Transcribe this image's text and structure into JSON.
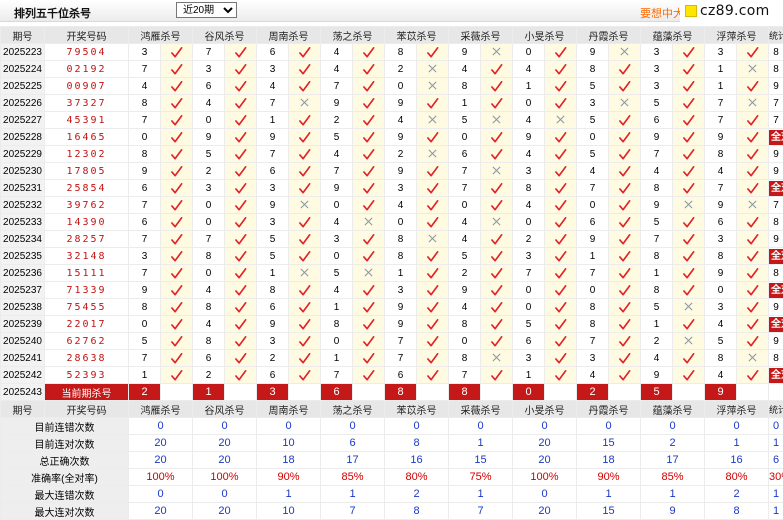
{
  "header": {
    "title": "排列五千位杀号",
    "select_value": "近20期",
    "promo": "要想中大"
  },
  "watermark": {
    "text": "cz89.com"
  },
  "columns": {
    "period": "期号",
    "draw": "开奖号码",
    "experts": [
      "鸿雁杀号",
      "谷风杀号",
      "周南杀号",
      "荡之杀号",
      "苯苡杀号",
      "采薇杀号",
      "小旻杀号",
      "丹霞杀号",
      "蕴藻杀号",
      "浮萍杀号"
    ],
    "stat": "统计"
  },
  "marks": {
    "hit": "✓",
    "miss": "✗",
    "all_correct": "全对"
  },
  "rows": [
    {
      "period": "2025223",
      "draw": "79504",
      "kills": [
        "3",
        "7",
        "6",
        "4",
        "8",
        "9",
        "0",
        "9",
        "3",
        "3"
      ],
      "hits": [
        1,
        1,
        1,
        1,
        1,
        0,
        1,
        0,
        1,
        1
      ],
      "stat": "8"
    },
    {
      "period": "2025224",
      "draw": "02192",
      "kills": [
        "7",
        "3",
        "3",
        "4",
        "2",
        "4",
        "4",
        "8",
        "3",
        "1"
      ],
      "hits": [
        1,
        1,
        1,
        1,
        0,
        1,
        1,
        1,
        1,
        0
      ],
      "stat": "8"
    },
    {
      "period": "2025225",
      "draw": "00907",
      "kills": [
        "4",
        "6",
        "4",
        "7",
        "0",
        "8",
        "1",
        "5",
        "3",
        "1"
      ],
      "hits": [
        1,
        1,
        1,
        1,
        0,
        1,
        1,
        1,
        1,
        1
      ],
      "stat": "9"
    },
    {
      "period": "2025226",
      "draw": "37327",
      "kills": [
        "8",
        "4",
        "7",
        "9",
        "9",
        "1",
        "0",
        "3",
        "5",
        "7"
      ],
      "hits": [
        1,
        1,
        0,
        1,
        1,
        1,
        1,
        0,
        1,
        0
      ],
      "stat": "7"
    },
    {
      "period": "2025227",
      "draw": "45391",
      "kills": [
        "7",
        "0",
        "1",
        "2",
        "4",
        "5",
        "4",
        "5",
        "6",
        "7"
      ],
      "hits": [
        1,
        1,
        1,
        1,
        0,
        0,
        0,
        1,
        1,
        1
      ],
      "stat": "7"
    },
    {
      "period": "2025228",
      "draw": "16465",
      "kills": [
        "0",
        "9",
        "9",
        "5",
        "9",
        "0",
        "9",
        "0",
        "9",
        "9"
      ],
      "hits": [
        1,
        1,
        1,
        1,
        1,
        1,
        1,
        1,
        1,
        1
      ],
      "stat": "全对"
    },
    {
      "period": "2025229",
      "draw": "12302",
      "kills": [
        "8",
        "5",
        "7",
        "4",
        "2",
        "6",
        "4",
        "5",
        "7",
        "8"
      ],
      "hits": [
        1,
        1,
        1,
        1,
        0,
        1,
        1,
        1,
        1,
        1
      ],
      "stat": "9"
    },
    {
      "period": "2025230",
      "draw": "17805",
      "kills": [
        "9",
        "2",
        "6",
        "7",
        "9",
        "7",
        "3",
        "4",
        "4",
        "4"
      ],
      "hits": [
        1,
        1,
        1,
        1,
        1,
        0,
        1,
        1,
        1,
        1
      ],
      "stat": "9"
    },
    {
      "period": "2025231",
      "draw": "25854",
      "kills": [
        "6",
        "3",
        "3",
        "9",
        "3",
        "7",
        "8",
        "7",
        "8",
        "7"
      ],
      "hits": [
        1,
        1,
        1,
        1,
        1,
        1,
        1,
        1,
        1,
        1
      ],
      "stat": "全对"
    },
    {
      "period": "2025232",
      "draw": "39762",
      "kills": [
        "7",
        "0",
        "9",
        "0",
        "4",
        "0",
        "4",
        "0",
        "9",
        "9"
      ],
      "hits": [
        1,
        1,
        0,
        1,
        1,
        1,
        1,
        1,
        0,
        0
      ],
      "stat": "7"
    },
    {
      "period": "2025233",
      "draw": "14390",
      "kills": [
        "6",
        "0",
        "3",
        "4",
        "0",
        "4",
        "0",
        "6",
        "5",
        "6"
      ],
      "hits": [
        1,
        1,
        1,
        0,
        1,
        0,
        1,
        1,
        1,
        1
      ],
      "stat": "8"
    },
    {
      "period": "2025234",
      "draw": "28257",
      "kills": [
        "7",
        "7",
        "5",
        "3",
        "8",
        "4",
        "2",
        "9",
        "7",
        "3"
      ],
      "hits": [
        1,
        1,
        1,
        1,
        0,
        1,
        1,
        1,
        1,
        1
      ],
      "stat": "9"
    },
    {
      "period": "2025235",
      "draw": "32148",
      "kills": [
        "3",
        "8",
        "5",
        "0",
        "8",
        "5",
        "3",
        "1",
        "8",
        "8"
      ],
      "hits": [
        1,
        1,
        1,
        1,
        1,
        1,
        1,
        1,
        1,
        1
      ],
      "stat": "全对"
    },
    {
      "period": "2025236",
      "draw": "15111",
      "kills": [
        "7",
        "0",
        "1",
        "5",
        "1",
        "2",
        "7",
        "7",
        "1",
        "9"
      ],
      "hits": [
        1,
        1,
        0,
        0,
        1,
        1,
        1,
        1,
        1,
        1
      ],
      "stat": "8"
    },
    {
      "period": "2025237",
      "draw": "71339",
      "kills": [
        "9",
        "4",
        "8",
        "4",
        "3",
        "9",
        "0",
        "0",
        "8",
        "0"
      ],
      "hits": [
        1,
        1,
        1,
        1,
        1,
        1,
        1,
        1,
        1,
        1
      ],
      "stat": "全对"
    },
    {
      "period": "2025238",
      "draw": "75455",
      "kills": [
        "8",
        "8",
        "6",
        "1",
        "9",
        "4",
        "0",
        "8",
        "5",
        "3"
      ],
      "hits": [
        1,
        1,
        1,
        1,
        1,
        1,
        1,
        1,
        0,
        1
      ],
      "stat": "9"
    },
    {
      "period": "2025239",
      "draw": "22017",
      "kills": [
        "0",
        "4",
        "9",
        "8",
        "9",
        "8",
        "5",
        "8",
        "1",
        "4"
      ],
      "hits": [
        1,
        1,
        1,
        1,
        1,
        1,
        1,
        1,
        1,
        1
      ],
      "stat": "全对"
    },
    {
      "period": "2025240",
      "draw": "62762",
      "kills": [
        "5",
        "8",
        "3",
        "0",
        "7",
        "0",
        "6",
        "7",
        "2",
        "5"
      ],
      "hits": [
        1,
        1,
        1,
        1,
        1,
        1,
        1,
        1,
        0,
        1
      ],
      "stat": "9"
    },
    {
      "period": "2025241",
      "draw": "28638",
      "kills": [
        "7",
        "6",
        "2",
        "1",
        "7",
        "8",
        "3",
        "3",
        "4",
        "8"
      ],
      "hits": [
        1,
        1,
        1,
        1,
        1,
        0,
        1,
        1,
        1,
        0
      ],
      "stat": "8"
    },
    {
      "period": "2025242",
      "draw": "52393",
      "kills": [
        "1",
        "2",
        "6",
        "7",
        "6",
        "7",
        "1",
        "4",
        "9",
        "4"
      ],
      "hits": [
        1,
        1,
        1,
        1,
        1,
        1,
        1,
        1,
        1,
        1
      ],
      "stat": "全对"
    }
  ],
  "current": {
    "period": "2025243",
    "label": "当前期杀号",
    "kills": [
      "2",
      "1",
      "3",
      "6",
      "8",
      "8",
      "0",
      "2",
      "5",
      "9"
    ]
  },
  "summary": {
    "labels": [
      "目前连错次数",
      "目前连对次数",
      "总正确次数",
      "准确率(全对率)",
      "最大连错次数",
      "最大连对次数"
    ],
    "values": [
      [
        "0",
        "0",
        "0",
        "0",
        "0",
        "0",
        "0",
        "0",
        "0",
        "0",
        "0"
      ],
      [
        "20",
        "20",
        "10",
        "6",
        "8",
        "1",
        "20",
        "15",
        "2",
        "1",
        "1"
      ],
      [
        "20",
        "20",
        "18",
        "17",
        "16",
        "15",
        "20",
        "18",
        "17",
        "16",
        "6"
      ],
      [
        "100%",
        "100%",
        "90%",
        "85%",
        "80%",
        "75%",
        "100%",
        "90%",
        "85%",
        "80%",
        "30%"
      ],
      [
        "0",
        "0",
        "1",
        "1",
        "2",
        "1",
        "0",
        "1",
        "1",
        "2",
        "1"
      ],
      [
        "20",
        "20",
        "10",
        "7",
        "8",
        "7",
        "20",
        "15",
        "9",
        "8",
        "1"
      ]
    ]
  }
}
